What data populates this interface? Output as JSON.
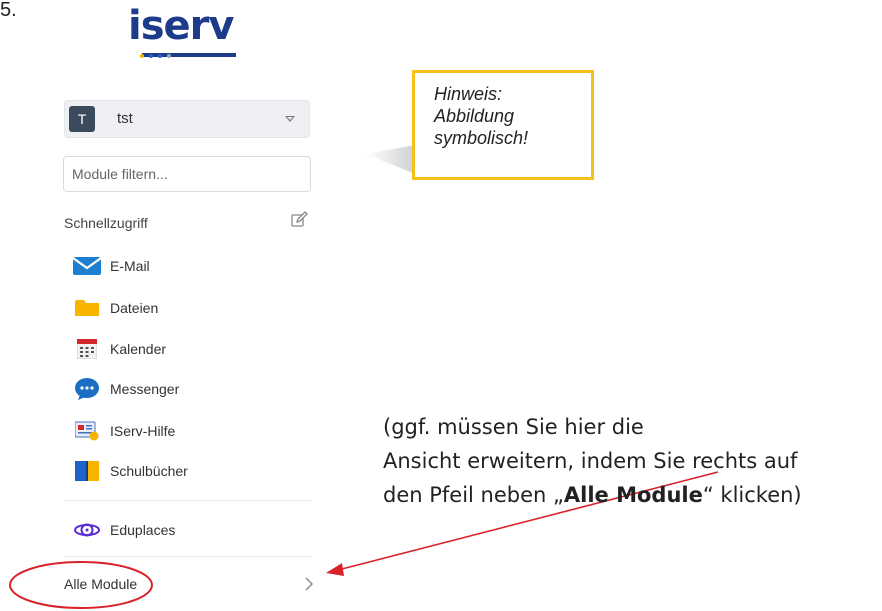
{
  "page": {
    "corner_fragment": "5."
  },
  "logo": {
    "text": "iserv",
    "dot_colors": [
      "#f4b400",
      "#2a62c9",
      "#2a62c9",
      "#9aa7b7"
    ]
  },
  "account": {
    "initial": "T",
    "name": "tst"
  },
  "filter": {
    "placeholder": "Module filtern..."
  },
  "quick_access": {
    "label": "Schnellzugriff",
    "items": [
      {
        "label": "E-Mail",
        "icon": "mail-icon"
      },
      {
        "label": "Dateien",
        "icon": "folder-icon"
      },
      {
        "label": "Kalender",
        "icon": "calendar-icon"
      },
      {
        "label": "Messenger",
        "icon": "chat-icon"
      },
      {
        "label": "IServ-Hilfe",
        "icon": "help-icon"
      },
      {
        "label": "Schulbücher",
        "icon": "book-icon"
      }
    ]
  },
  "extra_items": [
    {
      "label": "Eduplaces",
      "icon": "eduplaces-icon"
    }
  ],
  "all_modules": {
    "label": "Alle Module"
  },
  "note": {
    "lines": [
      "Hinweis:",
      "Abbildung",
      "symbolisch!"
    ]
  },
  "instruction": {
    "line1": "(ggf. müssen Sie hier die",
    "line2": "Ansicht erweitern, indem Sie rechts auf",
    "line3_prefix": "den Pfeil neben „",
    "line3_bold": "Alle Module",
    "line3_suffix": "“ klicken)"
  },
  "colors": {
    "annotation_red": "#d8232a",
    "note_border": "#f4c21b",
    "brand_blue": "#1e3a8a"
  }
}
